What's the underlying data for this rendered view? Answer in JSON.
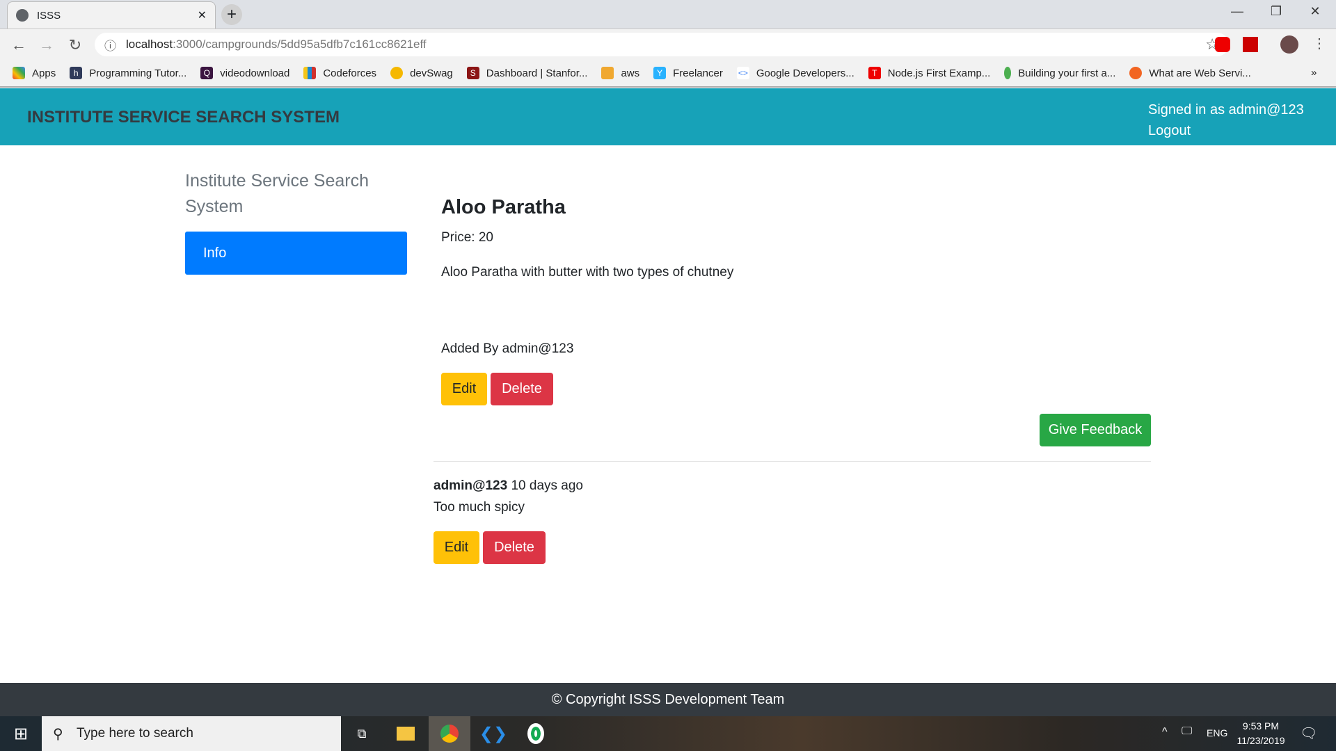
{
  "browser": {
    "tab_title": "ISSS",
    "url_host": "localhost",
    "url_path": ":3000/campgrounds/5dd95a5dfb7c161cc8621eff",
    "bookmarks": [
      "Apps",
      "Programming Tutor...",
      "videodownload",
      "Codeforces",
      "devSwag",
      "Dashboard | Stanfor...",
      "aws",
      "Freelancer",
      "Google Developers...",
      "Node.js First Examp...",
      "Building your first a...",
      "What are Web Servi..."
    ]
  },
  "navbar": {
    "brand": "INSTITUTE SERVICE SEARCH SYSTEM",
    "signed_in": "Signed in as admin@123",
    "logout": "Logout"
  },
  "sidebar": {
    "title": "Institute Service Search System",
    "items": [
      {
        "label": "Info"
      }
    ]
  },
  "item": {
    "name": "Aloo Paratha",
    "price": "Price: 20",
    "description": "Aloo Paratha with butter with two types of chutney",
    "added_by": "Added By admin@123",
    "edit": "Edit",
    "delete": "Delete"
  },
  "feedback_button": "Give Feedback",
  "comments": [
    {
      "author": "admin@123",
      "time": "10 days ago",
      "text": "Too much spicy",
      "edit": "Edit",
      "delete": "Delete"
    }
  ],
  "footer": "© Copyright ISSS Development Team",
  "taskbar": {
    "search_placeholder": "Type here to search",
    "lang": "ENG",
    "time": "9:53 PM",
    "date": "11/23/2019"
  },
  "colors": {
    "navbar": "#17a2b8",
    "primary": "#007bff",
    "warning": "#ffc107",
    "danger": "#dc3545",
    "success": "#28a745",
    "footer": "#343a40"
  }
}
